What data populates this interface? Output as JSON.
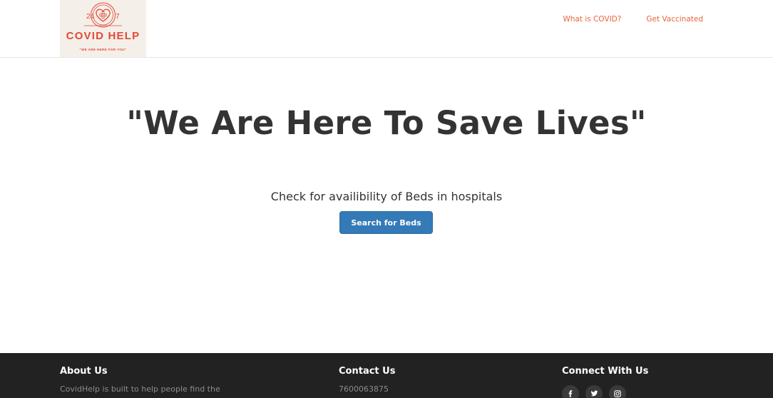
{
  "header": {
    "logo": {
      "title": "COVID HELP",
      "tagline": "\"WE ARE HERE FOR YOU\"",
      "number_left": "24",
      "number_right": "7"
    },
    "nav": [
      {
        "label": "What is COVID?"
      },
      {
        "label": "Get Vaccinated"
      }
    ]
  },
  "hero": {
    "title": "\"We Are Here To Save Lives\"",
    "subtitle": "Check for availibility of Beds in hospitals",
    "button_label": "Search for Beds"
  },
  "footer": {
    "about": {
      "heading": "About Us",
      "text": "CovidHelp is built to help people find the"
    },
    "contact": {
      "heading": "Contact Us",
      "phone": "7600063875"
    },
    "connect": {
      "heading": "Connect With Us",
      "icons": [
        "facebook-icon",
        "twitter-icon",
        "instagram-icon"
      ]
    }
  },
  "colors": {
    "accent": "#e8643c",
    "logo_red": "#e04a35",
    "button": "#337ab7",
    "footer_bg": "#222222",
    "text_dark": "#333333"
  }
}
